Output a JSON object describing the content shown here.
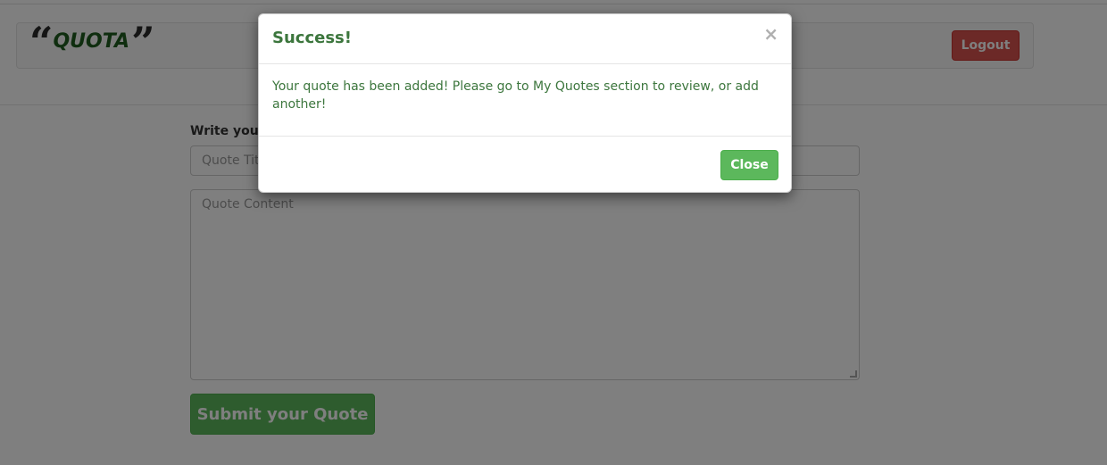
{
  "navbar": {
    "brand_name": "QUOTA",
    "brand_open_quote": "❝",
    "brand_close_quote": "❞",
    "logout_label": "Logout"
  },
  "form": {
    "label": "Write your",
    "title_placeholder": "Quote Title",
    "content_placeholder": "Quote Content",
    "submit_label": "Submit your Quote"
  },
  "modal": {
    "title": "Success!",
    "close_icon": "×",
    "message": "Your quote has been added! Please go to My Quotes section to review, or add another!",
    "close_label": "Close"
  },
  "colors": {
    "brand_green": "#1f5c1f",
    "success_green": "#5cb85c",
    "success_text": "#3c763d",
    "danger_red": "#d9534f"
  }
}
